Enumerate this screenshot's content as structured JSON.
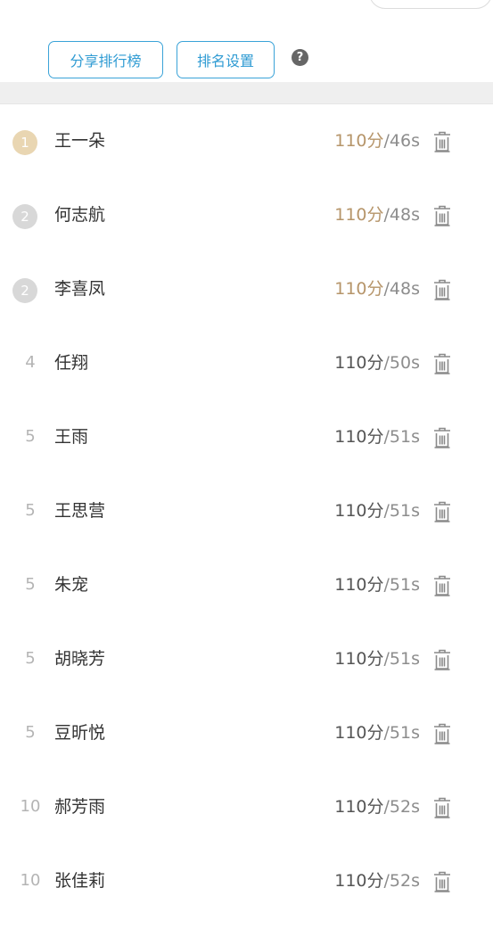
{
  "toolbar": {
    "share_label": "分享排行榜",
    "settings_label": "排名设置",
    "help_icon": "?"
  },
  "colors": {
    "accent": "#3aa3d8",
    "gold_score": "#b6956a",
    "medal_gold": "#e9d6b2",
    "medal_silver": "#d8d8d8"
  },
  "leaderboard": [
    {
      "rank": "1",
      "name": "王一朵",
      "points": "110分",
      "time": "/46s",
      "medal": "gold"
    },
    {
      "rank": "2",
      "name": "何志航",
      "points": "110分",
      "time": "/48s",
      "medal": "silver"
    },
    {
      "rank": "2",
      "name": "李喜凤",
      "points": "110分",
      "time": "/48s",
      "medal": "silver"
    },
    {
      "rank": "4",
      "name": "任翔",
      "points": "110分",
      "time": "/50s",
      "medal": ""
    },
    {
      "rank": "5",
      "name": "王雨",
      "points": "110分",
      "time": "/51s",
      "medal": ""
    },
    {
      "rank": "5",
      "name": "王思营",
      "points": "110分",
      "time": "/51s",
      "medal": ""
    },
    {
      "rank": "5",
      "name": "朱宠",
      "points": "110分",
      "time": "/51s",
      "medal": ""
    },
    {
      "rank": "5",
      "name": "胡晓芳",
      "points": "110分",
      "time": "/51s",
      "medal": ""
    },
    {
      "rank": "5",
      "name": "豆昕悦",
      "points": "110分",
      "time": "/51s",
      "medal": ""
    },
    {
      "rank": "10",
      "name": "郝芳雨",
      "points": "110分",
      "time": "/52s",
      "medal": ""
    },
    {
      "rank": "10",
      "name": "张佳莉",
      "points": "110分",
      "time": "/52s",
      "medal": ""
    }
  ],
  "icons": {
    "delete": "trash-icon"
  }
}
